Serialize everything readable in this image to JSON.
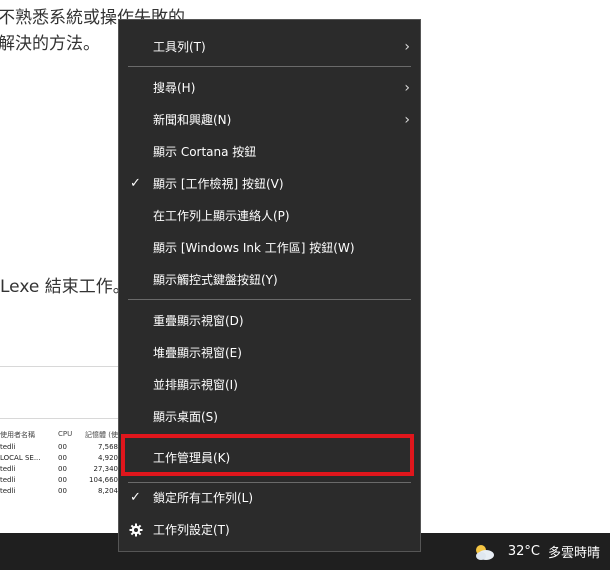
{
  "background": {
    "line1": "不熟悉系統或操作失敗的",
    "line2": "解決的方法。",
    "line3": "Lexe 結束工作。"
  },
  "task_manager": {
    "headers": [
      "使用者名稱",
      "CPU",
      "記憶體 (使"
    ],
    "rows": [
      [
        "tedli",
        "00",
        "7,568"
      ],
      [
        "LOCAL SE...",
        "00",
        "4,920"
      ],
      [
        "tedli",
        "00",
        "27,340"
      ],
      [
        "tedli",
        "00",
        "104,660"
      ],
      [
        "tedli",
        "00",
        "8,204"
      ]
    ]
  },
  "context_menu": {
    "items": [
      {
        "label": "工具列(T)",
        "submenu": true
      },
      {
        "label": "搜尋(H)",
        "submenu": true
      },
      {
        "label": "新聞和興趣(N)",
        "submenu": true
      },
      {
        "label": "顯示 Cortana 按鈕"
      },
      {
        "label": "顯示 [工作檢視] 按鈕(V)",
        "checked": true
      },
      {
        "label": "在工作列上顯示連絡人(P)"
      },
      {
        "label": "顯示 [Windows Ink 工作區] 按鈕(W)"
      },
      {
        "label": "顯示觸控式鍵盤按鈕(Y)"
      },
      {
        "label": "重疊顯示視窗(D)"
      },
      {
        "label": "堆疊顯示視窗(E)"
      },
      {
        "label": "並排顯示視窗(I)"
      },
      {
        "label": "顯示桌面(S)"
      },
      {
        "label": "工作管理員(K)",
        "highlighted": true
      },
      {
        "label": "鎖定所有工作列(L)",
        "checked": true
      },
      {
        "label": "工作列設定(T)",
        "icon": "gear-icon"
      }
    ],
    "check_glyph": "✓",
    "arrow_glyph": "›"
  },
  "taskbar": {
    "weather_icon": "cloud-sun-icon",
    "temperature": "32°C",
    "condition": "多雲時晴"
  },
  "colors": {
    "menu_bg": "#2b2b2b",
    "highlight_border": "#e0161c",
    "taskbar_bg": "#1f1f1f"
  }
}
